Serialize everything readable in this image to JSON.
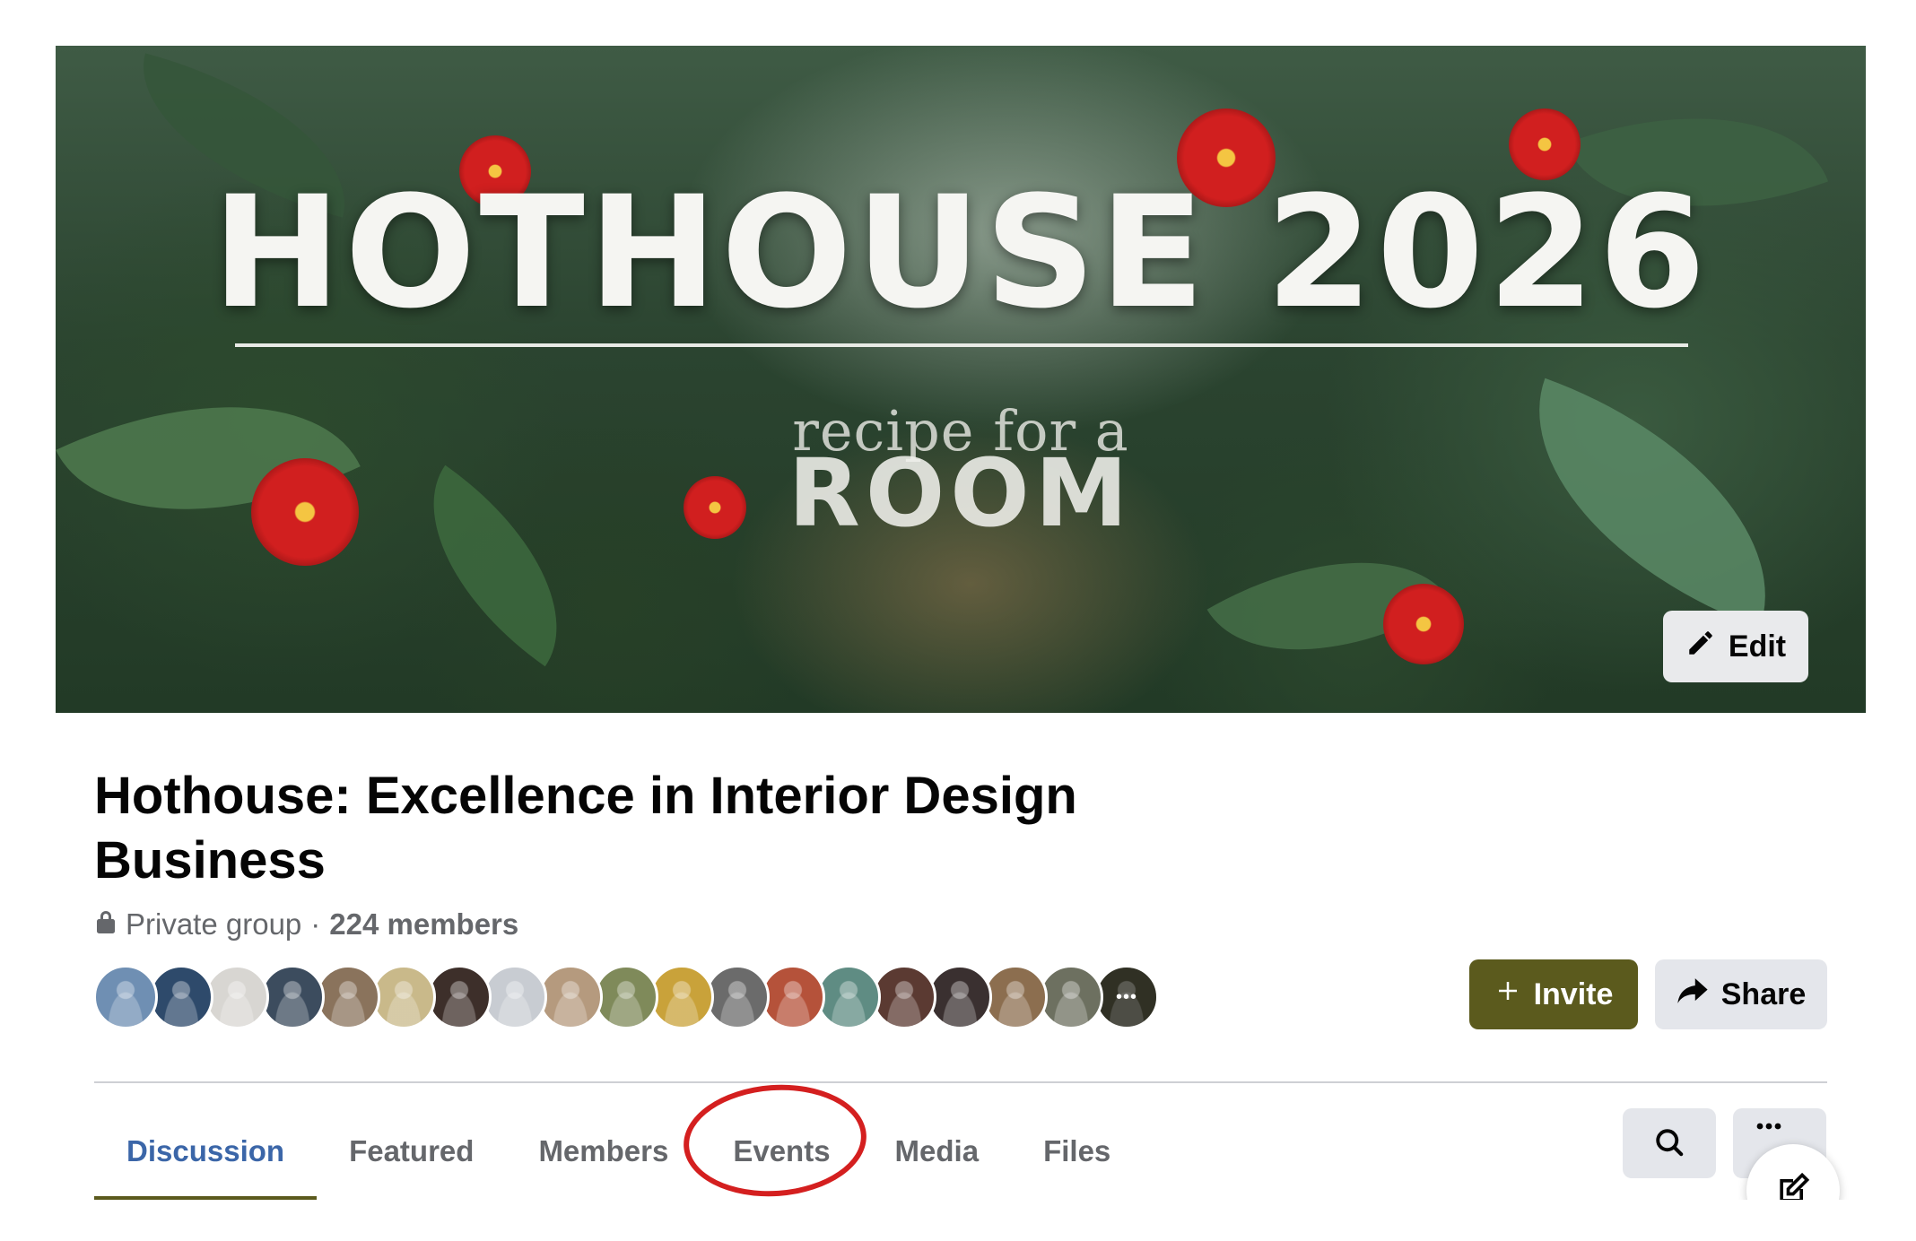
{
  "cover": {
    "title": "HOTHOUSE 2026",
    "subtitle_script": "recipe for a",
    "subtitle_bold": "ROOM",
    "edit_label": "Edit"
  },
  "group": {
    "name": "Hothouse: Excellence in Interior Design Business",
    "privacy": "Private group",
    "separator": "·",
    "members": "224 members"
  },
  "avatars": [
    {
      "color": "#6f8fb3"
    },
    {
      "color": "#2e4a6b"
    },
    {
      "color": "#d8d6d2"
    },
    {
      "color": "#3c4c5e"
    },
    {
      "color": "#8a735c"
    },
    {
      "color": "#c9b98a"
    },
    {
      "color": "#3d2f2a"
    },
    {
      "color": "#c8ccd2"
    },
    {
      "color": "#b59a7e"
    },
    {
      "color": "#7f8a5a"
    },
    {
      "color": "#c9a23a"
    },
    {
      "color": "#6b6b6b"
    },
    {
      "color": "#b5523a"
    },
    {
      "color": "#5f8c83"
    },
    {
      "color": "#5b3a32"
    },
    {
      "color": "#3a3030"
    },
    {
      "color": "#8c6e4f"
    },
    {
      "color": "#6d7060"
    },
    {
      "color": "#4a4a38"
    }
  ],
  "actions": {
    "invite_label": "Invite",
    "share_label": "Share"
  },
  "tabs": [
    {
      "label": "Discussion",
      "active": true
    },
    {
      "label": "Featured",
      "active": false
    },
    {
      "label": "Members",
      "active": false
    },
    {
      "label": "Events",
      "active": false
    },
    {
      "label": "Media",
      "active": false
    },
    {
      "label": "Files",
      "active": false
    }
  ],
  "colors": {
    "accent": "#5b5a1d",
    "active_tab": "#3b66a8",
    "annotation": "#d41f1f"
  },
  "icons": {
    "edit": "pencil-icon",
    "lock": "lock-icon",
    "invite": "plus-icon",
    "share": "share-arrow-icon",
    "search": "search-icon",
    "more": "more-icon",
    "compose": "compose-icon"
  }
}
